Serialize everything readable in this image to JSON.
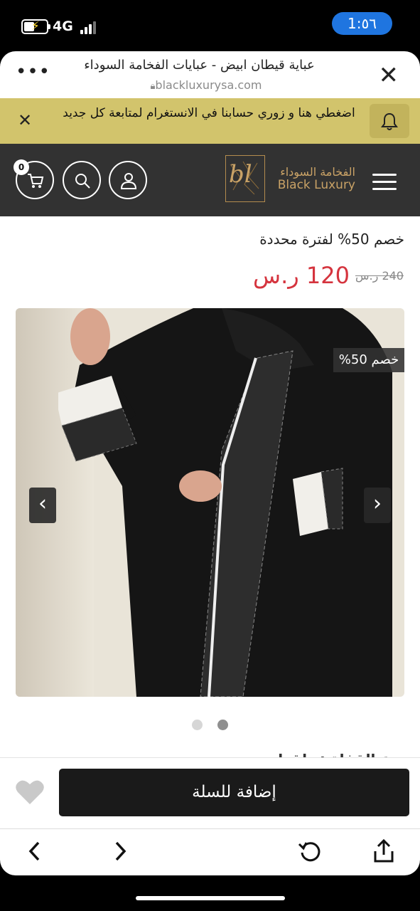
{
  "status_bar": {
    "network": "4G",
    "time": "1:٥٦"
  },
  "browser": {
    "title": "عباية قيطان ابيض - عبايات الفخامة السوداء",
    "url": "blackluxurysa.com",
    "more_icon": "more-dots-icon",
    "close_icon": "close-icon"
  },
  "announcement": {
    "text": "اضغطي هنا و زوري حسابنا في الانستغرام لمتابعة كل جديد",
    "bell_icon": "bell-icon"
  },
  "store_header": {
    "cart_count": "0",
    "logo_monogram": "bl",
    "logo_arabic": "الفخامة السوداء",
    "logo_english": "Black Luxury"
  },
  "product": {
    "sale_heading": "خصم 50% لفترة محددة",
    "old_price": "240 ر.س",
    "new_price": "120 ر.س",
    "discount_badge": "خصم 50%",
    "gallery_dots": 2,
    "active_dot": 2,
    "cut_off_text": "نوع القفلة : طقطق"
  },
  "cart_bar": {
    "add_to_cart": "إضافة للسلة"
  },
  "colors": {
    "announcement_bg": "#d2c46c",
    "header_bg": "#323232",
    "gold": "#c9a266",
    "price_red": "#d5343e",
    "status_pill": "#1f75e0"
  }
}
